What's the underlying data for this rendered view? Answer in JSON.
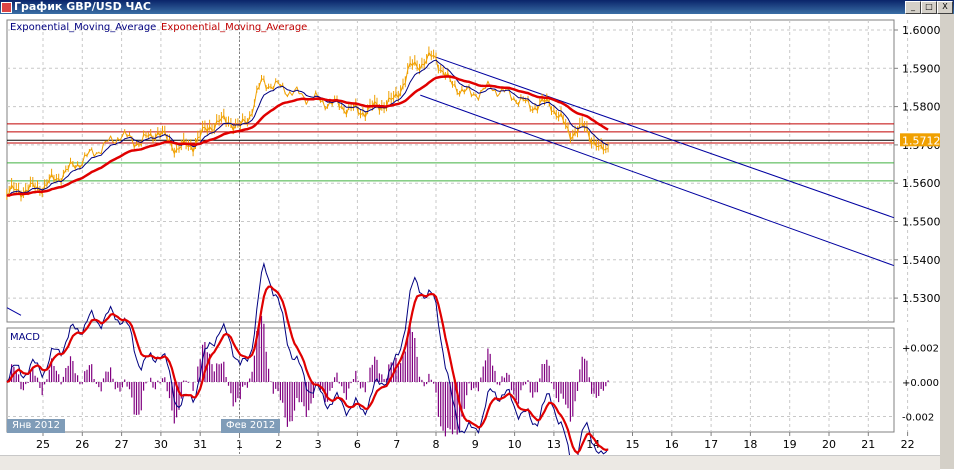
{
  "window": {
    "title": "График GBP/USD ЧАС",
    "buttons": [
      "_",
      "□",
      "X"
    ]
  },
  "legend": {
    "fast": "Exponential_Moving_Average",
    "slow": "Exponential_Moving_Average"
  },
  "colors": {
    "price": "#f0a000",
    "ema_fast": "#000080",
    "ema_slow": "#e00000",
    "macd_hist": "#800080",
    "channel": "#0000a0",
    "resistance": "#c00000",
    "support": "#40b040",
    "grid": "#c8c8c8",
    "badge": "#7f9cb8"
  },
  "price_axis": {
    "ticks": [
      "1.6000",
      "1.5900",
      "1.5800",
      "1.5700",
      "1.5600",
      "1.5500",
      "1.5400",
      "1.5300"
    ],
    "current": "1.5712"
  },
  "macd": {
    "label": "MACD",
    "ticks": [
      "+0.002",
      "+0.000",
      "-0.002"
    ]
  },
  "months": [
    "Янв 2012",
    "Фев 2012"
  ],
  "dates": [
    "25",
    "26",
    "27",
    "30",
    "31",
    "1",
    "2",
    "3",
    "6",
    "7",
    "8",
    "9",
    "10",
    "13",
    "14",
    "15",
    "16",
    "17",
    "18",
    "19",
    "20",
    "21",
    "22"
  ],
  "chart_data": {
    "type": "line",
    "title": "GBP/USD H1",
    "ylim": [
      1.525,
      1.603
    ],
    "price_keypoints": [
      [
        -0.92,
        1.5575
      ],
      [
        0,
        1.559
      ],
      [
        0.45,
        1.562
      ],
      [
        1,
        1.566
      ],
      [
        1.45,
        1.569
      ],
      [
        1.96,
        1.5725
      ],
      [
        2.47,
        1.5705
      ],
      [
        2.93,
        1.5735
      ],
      [
        3.4,
        1.569
      ],
      [
        3.82,
        1.57
      ],
      [
        4.25,
        1.575
      ],
      [
        4.73,
        1.5765
      ],
      [
        5.0,
        1.574
      ],
      [
        5.27,
        1.578
      ],
      [
        5.57,
        1.5865
      ],
      [
        6.03,
        1.585
      ],
      [
        6.54,
        1.583
      ],
      [
        7.05,
        1.5815
      ],
      [
        7.63,
        1.58
      ],
      [
        8.06,
        1.5785
      ],
      [
        8.5,
        1.58
      ],
      [
        8.95,
        1.5815
      ],
      [
        9.34,
        1.59
      ],
      [
        9.97,
        1.593
      ],
      [
        10.36,
        1.586
      ],
      [
        10.9,
        1.583
      ],
      [
        11.4,
        1.585
      ],
      [
        11.9,
        1.583
      ],
      [
        12.4,
        1.58
      ],
      [
        12.9,
        1.581
      ],
      [
        13.4,
        1.573
      ],
      [
        13.8,
        1.5745
      ],
      [
        14.2,
        1.568
      ],
      [
        14.4,
        1.5695
      ]
    ],
    "horizontal_levels": {
      "resistance": [
        1.5755,
        1.5734,
        1.5705
      ],
      "current": 1.5712,
      "support": [
        1.5653,
        1.5606
      ]
    },
    "channel": {
      "upper": [
        [
          9.97,
          1.593
        ],
        [
          21.65,
          1.551
        ]
      ],
      "lower": [
        [
          9.6,
          1.583
        ],
        [
          21.65,
          1.5385
        ]
      ]
    },
    "macd_ylim": [
      -0.0026,
      0.003
    ]
  }
}
